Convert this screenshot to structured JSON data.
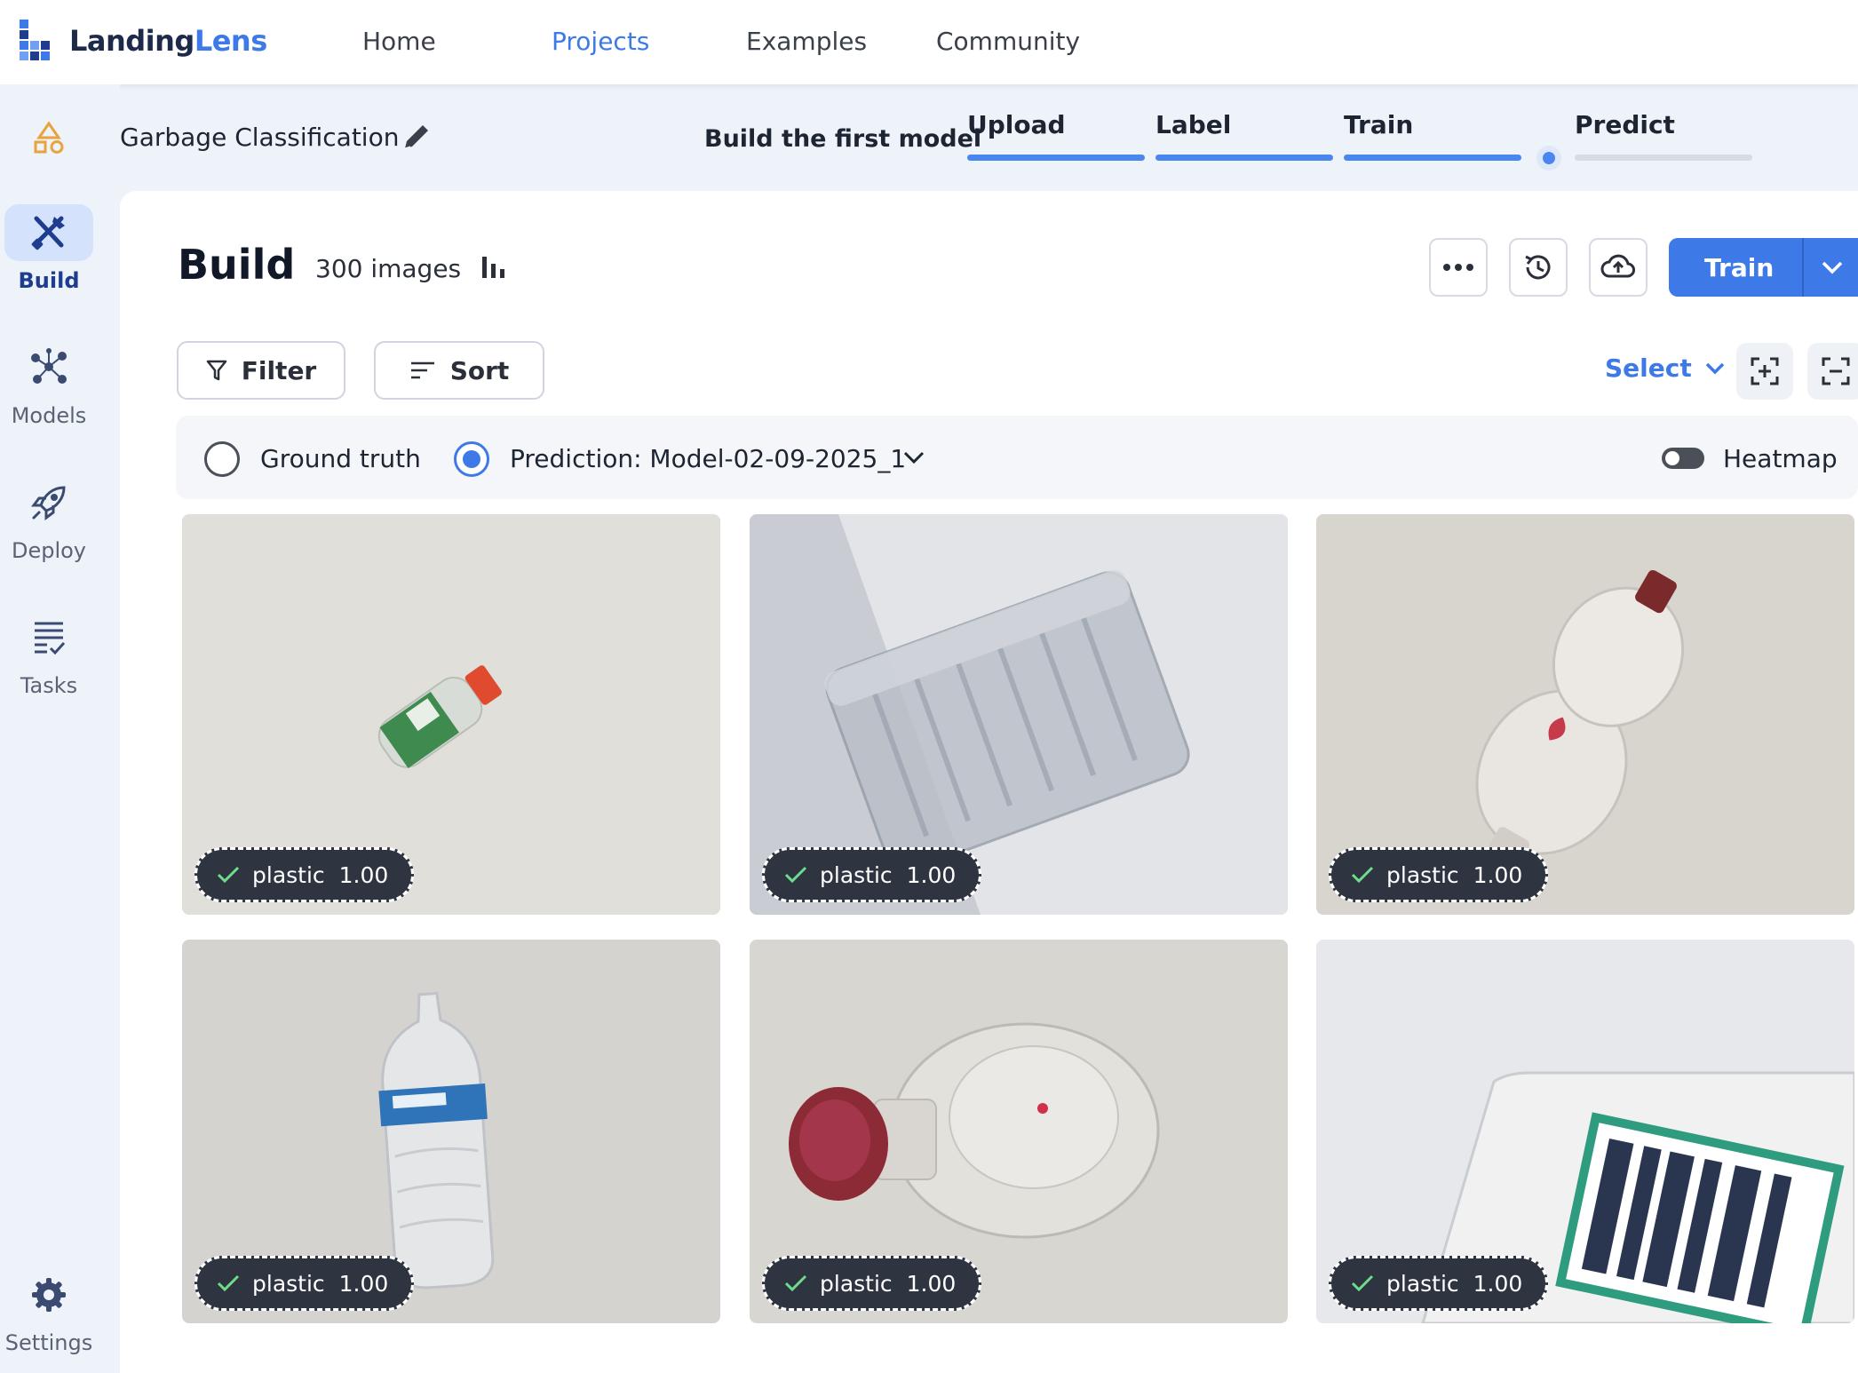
{
  "app": {
    "logo_part1": "Landing",
    "logo_part2": "Lens",
    "nav": [
      "Home",
      "Projects",
      "Examples",
      "Community"
    ],
    "active_nav": "Projects"
  },
  "project": {
    "name": "Garbage Classification",
    "steps_title": "Build the first model",
    "steps": [
      {
        "label": "Upload",
        "status": "done"
      },
      {
        "label": "Label",
        "status": "done"
      },
      {
        "label": "Train",
        "status": "done"
      },
      {
        "label": "Predict",
        "status": "current"
      }
    ]
  },
  "sidebar": {
    "items": [
      {
        "label": "Build",
        "icon": "tools-icon",
        "active": true
      },
      {
        "label": "Models",
        "icon": "network-icon",
        "active": false
      },
      {
        "label": "Deploy",
        "icon": "rocket-icon",
        "active": false
      },
      {
        "label": "Tasks",
        "icon": "task-list-icon",
        "active": false
      }
    ],
    "settings_label": "Settings"
  },
  "build": {
    "title": "Build",
    "image_count": "300 images",
    "train_label": "Train",
    "filter_label": "Filter",
    "sort_label": "Sort",
    "select_label": "Select",
    "ground_truth_label": "Ground truth",
    "prediction_label": "Prediction: Model-02-09-2025_1",
    "heatmap_label": "Heatmap",
    "heatmap_on": false,
    "selected_view": "prediction"
  },
  "images": [
    {
      "label": "plastic",
      "score": "1.00"
    },
    {
      "label": "plastic",
      "score": "1.00"
    },
    {
      "label": "plastic",
      "score": "1.00"
    },
    {
      "label": "plastic",
      "score": "1.00"
    },
    {
      "label": "plastic",
      "score": "1.00"
    },
    {
      "label": "plastic",
      "score": "1.00"
    }
  ],
  "colors": {
    "accent": "#3d7ae8",
    "badge_bg": "#2e3440",
    "sidebar_bg": "#eef2f9",
    "active_side_bg": "#d4e2fb"
  }
}
